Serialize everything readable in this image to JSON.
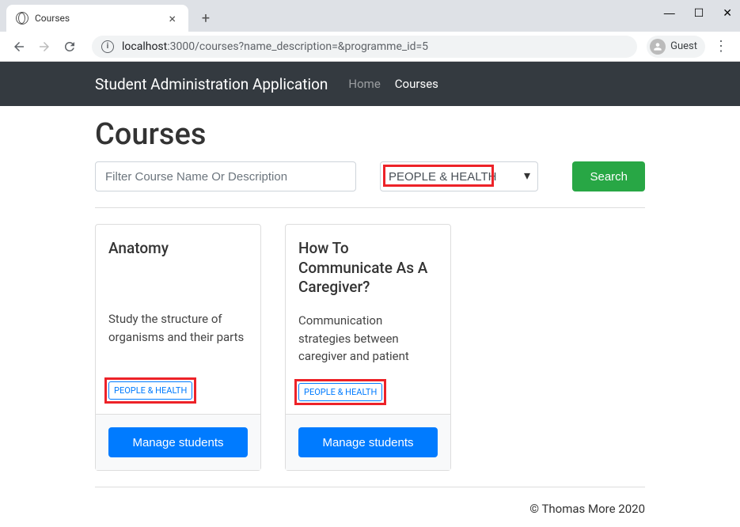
{
  "browser": {
    "tab_title": "Courses",
    "guest_label": "Guest",
    "url_host": "localhost",
    "url_port_path": ":3000/courses?name_description=&programme_id=5"
  },
  "navbar": {
    "brand": "Student Administration Application",
    "links": [
      {
        "label": "Home",
        "active": false
      },
      {
        "label": "Courses",
        "active": true
      }
    ]
  },
  "page": {
    "title": "Courses",
    "filter_placeholder": "Filter Course Name Or Description",
    "filter_value": "",
    "selected_programme": "PEOPLE & HEALTH",
    "search_label": "Search"
  },
  "courses": [
    {
      "title": "Anatomy",
      "description": "Study the structure of organisms and their parts",
      "programme": "PEOPLE & HEALTH",
      "manage_label": "Manage students"
    },
    {
      "title": "How To Communicate As A Caregiver?",
      "description": "Communication strategies between caregiver and patient",
      "programme": "PEOPLE & HEALTH",
      "manage_label": "Manage students"
    }
  ],
  "footer": "© Thomas More 2020",
  "highlight_color": "#ed2228"
}
